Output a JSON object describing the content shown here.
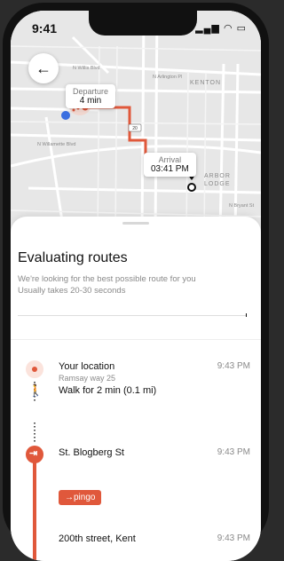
{
  "status_bar": {
    "time": "9:41",
    "icons": "▂▄▆ ◠ ▭"
  },
  "map": {
    "departure": {
      "label": "Departure",
      "value": "4 min"
    },
    "arrival": {
      "label": "Arrival",
      "value": "03:41 PM"
    },
    "streets": [
      "N Willis Blvd",
      "N Arlington Pl",
      "KENTON",
      "N Willamette Blvd",
      "ARBOR",
      "LODGE",
      "N Bryant St",
      "N Fowler Ave",
      "N Curtis Ave",
      "N Burrage Ave",
      "N Endicott Ave",
      "N Albina Ave",
      "N Curtis Ave"
    ],
    "route_color": "#e0583b"
  },
  "back_button": {
    "icon": "arrow-left-icon",
    "glyph": "←"
  },
  "sheet": {
    "title": "Evaluating routes",
    "subtitle_line1": "We're looking for the best possible route for you",
    "subtitle_line2": "Usually takes 20-30 seconds",
    "progress_fraction": 1.0
  },
  "steps": [
    {
      "name": "Your location",
      "detail": "Ramsay way 25",
      "time": "9:43 PM"
    },
    {
      "name": "Walk for 2 min (0.1 mi)",
      "detail": "",
      "time": ""
    },
    {
      "name": "St. Blogberg St",
      "detail": "",
      "time": "9:43 PM"
    },
    {
      "name": "200th street, Kent",
      "detail": "",
      "time": "9:43 PM"
    }
  ],
  "brand_badge": "→pingo",
  "colors": {
    "accent": "#e0583b",
    "map_bg": "#e7e7e7"
  }
}
